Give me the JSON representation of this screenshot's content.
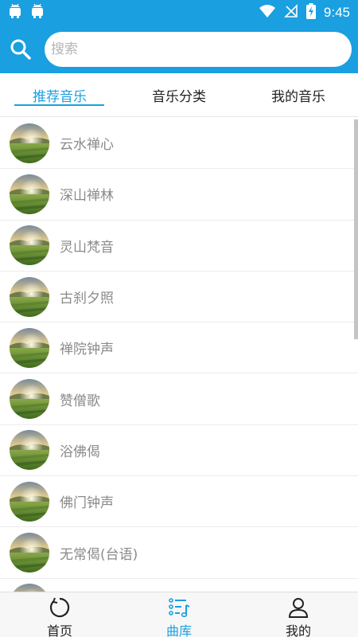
{
  "status_bar": {
    "time": "9:45",
    "icons": [
      "android-icon",
      "android-icon",
      "wifi-icon",
      "no-signal-icon",
      "battery-charging-icon"
    ]
  },
  "search": {
    "placeholder": "搜索",
    "value": ""
  },
  "tabs": [
    {
      "label": "推荐音乐",
      "active": true
    },
    {
      "label": "音乐分类",
      "active": false
    },
    {
      "label": "我的音乐",
      "active": false
    }
  ],
  "songs": [
    {
      "title": "云水禅心"
    },
    {
      "title": "深山禅林"
    },
    {
      "title": "灵山梵音"
    },
    {
      "title": "古刹夕照"
    },
    {
      "title": "禅院钟声"
    },
    {
      "title": "赞僧歌"
    },
    {
      "title": "浴佛偈"
    },
    {
      "title": "佛门钟声"
    },
    {
      "title": "无常偈(台语)"
    },
    {
      "title": ""
    }
  ],
  "bottom_nav": [
    {
      "label": "首页",
      "icon": "home-ring-icon",
      "active": false
    },
    {
      "label": "曲库",
      "icon": "music-library-icon",
      "active": true
    },
    {
      "label": "我的",
      "icon": "user-icon",
      "active": false
    }
  ],
  "colors": {
    "primary": "#1a9fe0",
    "item_text": "#8a8a8a",
    "divider": "#ececec"
  }
}
